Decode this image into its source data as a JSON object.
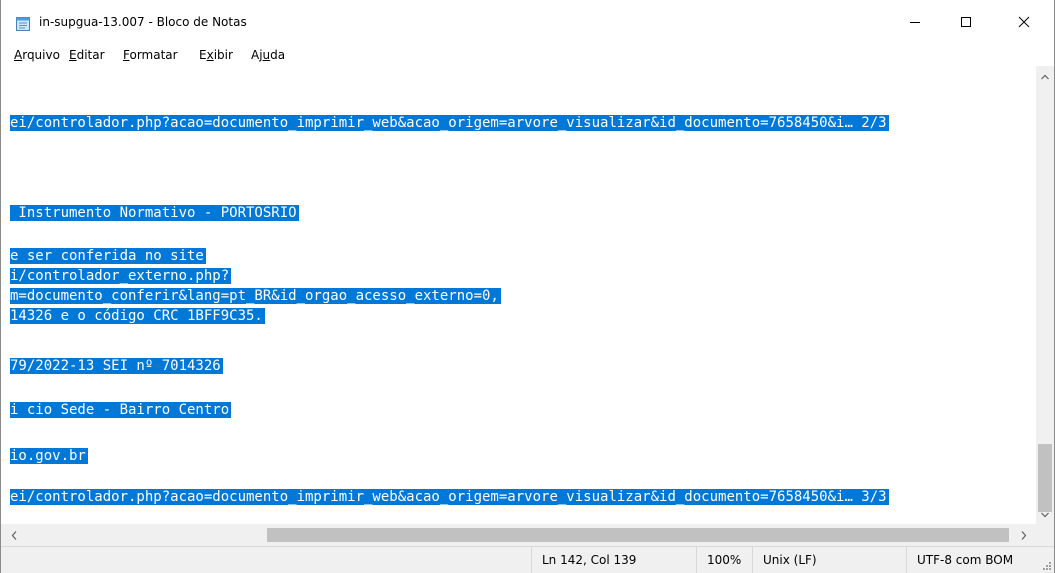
{
  "window": {
    "title": "in-supgua-13.007 - Bloco de Notas"
  },
  "menu": [
    {
      "mnemonic": "A",
      "rest": "rquivo"
    },
    {
      "mnemonic": "E",
      "rest": "ditar"
    },
    {
      "mnemonic": "F",
      "rest": "ormatar"
    },
    {
      "mnemonic": "x",
      "pre": "E",
      "rest": "ibir"
    },
    {
      "pre": "Aj",
      "mnemonic": "u",
      "rest": "da"
    }
  ],
  "editor": {
    "lines": [
      "ei/controlador.php?acao=documento_imprimir_web&acao_origem=arvore_visualizar&id_documento=7658450&i… 2/3",
      " Instrumento Normativo - PORTOSRIO",
      "e ser conferida no site",
      "i/controlador_externo.php?",
      "m=documento_conferir&lang=pt_BR&id_orgao_acesso_externo=0,",
      "14326 e o código CRC 1BFF9C35.",
      "79/2022-13 SEI nº 7014326",
      "i cio Sede - Bairro Centro",
      "io.gov.br",
      "ei/controlador.php?acao=documento_imprimir_web&acao_origem=arvore_visualizar&id_documento=7658450&i… 3/3"
    ]
  },
  "status": {
    "position": "Ln 142, Col 139",
    "zoom": "100%",
    "line_ending": "Unix (LF)",
    "encoding": "UTF-8 com BOM"
  },
  "colors": {
    "selection": "#0078d7",
    "scrollbar_track": "#f0f0f0",
    "scrollbar_thumb": "#c1c1c1"
  }
}
